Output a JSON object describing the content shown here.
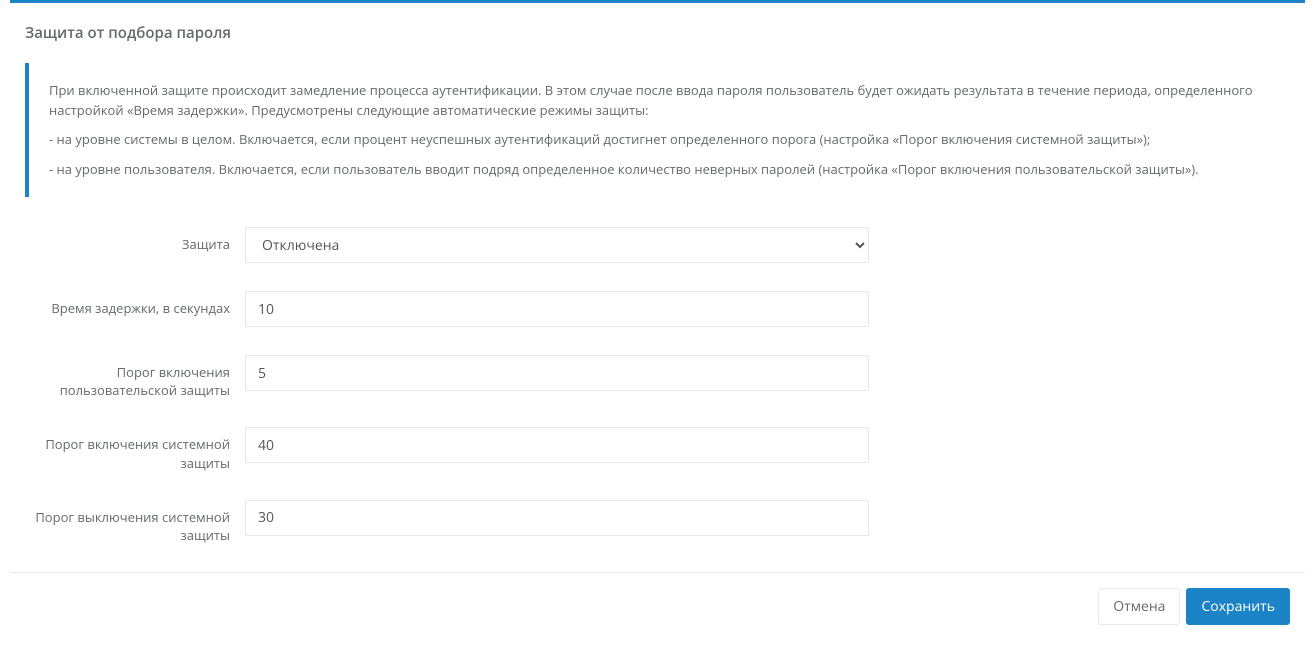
{
  "section": {
    "title": "Защита от подбора пароля"
  },
  "info": {
    "p1": "При включенной защите происходит замедление процесса аутентификации. В этом случае после ввода пароля пользователь будет ожидать результата в течение периода, определенного настройкой «Время задержки». Предусмотрены следующие автоматические режимы защиты:",
    "p2": "- на уровне системы в целом. Включается, если процент неуспешных аутентификаций достигнет определенного порога (настройка «Порог включения системной защиты»);",
    "p3": "- на уровне пользователя. Включается, если пользователь вводит подряд определенное количество неверных паролей (настройка «Порог включения пользовательской защиты»)."
  },
  "form": {
    "protection": {
      "label": "Защита",
      "selected": "Отключена",
      "options": [
        "Отключена"
      ]
    },
    "delay": {
      "label": "Время задержки, в секундах",
      "value": "10"
    },
    "user_threshold": {
      "label": "Порог включения пользовательской защиты",
      "value": "5"
    },
    "system_on_threshold": {
      "label": "Порог включения системной защиты",
      "value": "40"
    },
    "system_off_threshold": {
      "label": "Порог выключения системной защиты",
      "value": "30"
    }
  },
  "buttons": {
    "cancel": "Отмена",
    "save": "Сохранить"
  }
}
